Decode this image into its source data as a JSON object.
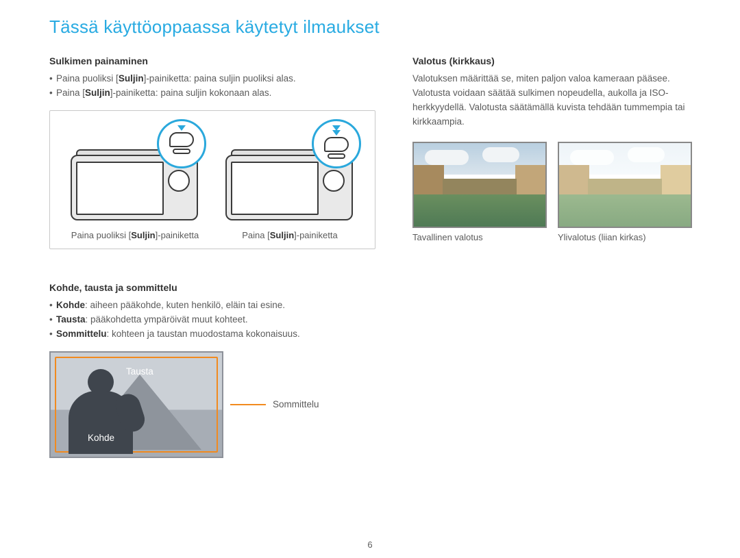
{
  "page": {
    "title": "Tässä käyttöoppaassa käytetyt ilmaukset",
    "number": "6"
  },
  "left": {
    "shutter": {
      "header": "Sulkimen painaminen",
      "bullets": [
        {
          "prefix": "Paina puoliksi [",
          "bold": "Suljin",
          "suffix": "]-painiketta: paina suljin puoliksi alas."
        },
        {
          "prefix": "Paina [",
          "bold": "Suljin",
          "suffix": "]-painiketta: paina suljin kokonaan alas."
        }
      ],
      "fig1": {
        "pre": "Paina puoliksi [",
        "bold": "Suljin",
        "post": "]-painiketta"
      },
      "fig2": {
        "pre": "Paina [",
        "bold": "Suljin",
        "post": "]-painiketta"
      }
    },
    "composition": {
      "header": "Kohde, tausta ja sommittelu",
      "bullets": [
        {
          "bold": "Kohde",
          "text": ": aiheen pääkohde, kuten henkilö, eläin tai esine."
        },
        {
          "bold": "Tausta",
          "text": ": pääkohdetta ympäröivät muut kohteet."
        },
        {
          "bold": "Sommittelu",
          "text": ": kohteen ja taustan muodostama kokonaisuus."
        }
      ],
      "labels": {
        "tausta": "Tausta",
        "kohde": "Kohde",
        "sommittelu": "Sommittelu"
      }
    }
  },
  "right": {
    "exposure": {
      "header": "Valotus (kirkkaus)",
      "paragraph": "Valotuksen määrittää se, miten paljon valoa kameraan pääsee. Valotusta voidaan säätää sulkimen nopeudella, aukolla ja ISO-herkkyydellä. Valotusta säätämällä kuvista tehdään tummempia tai kirkkaampia.",
      "captions": {
        "normal": "Tavallinen valotus",
        "over": "Ylivalotus (liian kirkas)"
      }
    }
  }
}
